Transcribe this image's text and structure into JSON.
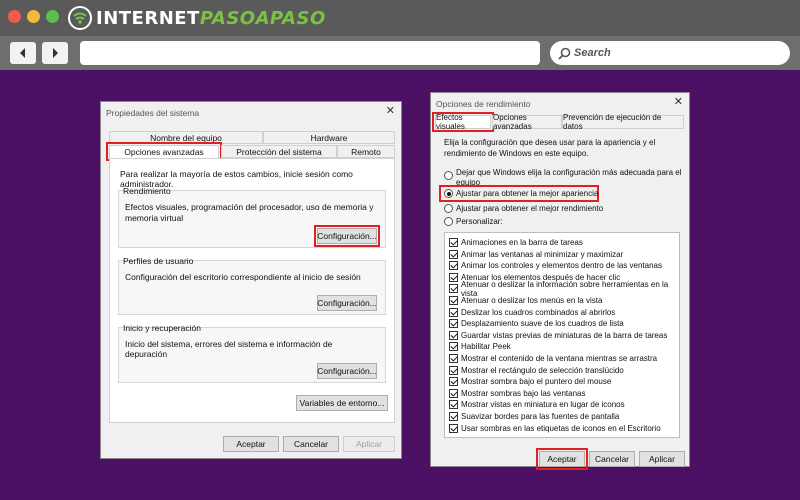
{
  "brand": {
    "name_white_1": "INTERNET",
    "name_green": "PASOAPASO",
    "colors": {
      "green": "#7cc242",
      "background": "#4b0f63",
      "highlight": "#e01f26"
    }
  },
  "browser": {
    "search_placeholder": "Search",
    "icons": [
      "back-arrow-icon",
      "forward-arrow-icon",
      "search-icon"
    ]
  },
  "system_properties": {
    "title": "Propiedades del sistema",
    "close": "✕",
    "tabs_row1": [
      "Nombre del equipo",
      "Hardware"
    ],
    "tabs_row2": [
      "Opciones avanzadas",
      "Protección del sistema",
      "Remoto"
    ],
    "admin_note": "Para realizar la mayoría de estos cambios, inicie sesión como administrador.",
    "performance": {
      "title": "Rendimiento",
      "desc": "Efectos visuales, programación del procesador, uso de memoria y memoria virtual",
      "button": "Configuración..."
    },
    "profiles": {
      "title": "Perfiles de usuario",
      "desc": "Configuración del escritorio correspondiente al inicio de sesión",
      "button": "Configuración..."
    },
    "startup": {
      "title": "Inicio y recuperación",
      "desc": "Inicio del sistema, errores del sistema e información de depuración",
      "button": "Configuración..."
    },
    "env_button": "Variables de entorno...",
    "ok": "Aceptar",
    "cancel": "Cancelar",
    "apply": "Aplicar"
  },
  "performance_options": {
    "title": "Opciones de rendimiento",
    "close": "✕",
    "tabs": [
      "Efectos visuales",
      "Opciones avanzadas",
      "Prevención de ejecución de datos"
    ],
    "intro": "Elija la configuración que desea usar para la apariencia y el rendimiento de Windows en este equipo.",
    "radios": [
      {
        "label": "Dejar que Windows elija la configuración más adecuada para el equipo",
        "checked": false
      },
      {
        "label": "Ajustar para obtener la mejor apariencia",
        "checked": true
      },
      {
        "label": "Ajustar para obtener el mejor rendimiento",
        "checked": false
      },
      {
        "label": "Personalizar:",
        "checked": false
      }
    ],
    "effects": [
      "Animaciones en la barra de tareas",
      "Animar las ventanas al minimizar y maximizar",
      "Animar los controles y elementos dentro de las ventanas",
      "Atenuar los elementos después de hacer clic",
      "Atenuar o deslizar la información sobre herramientas en la vista",
      "Atenuar o deslizar los menús en la vista",
      "Deslizar los cuadros combinados al abrirlos",
      "Desplazamiento suave de los cuadros de lista",
      "Guardar vistas previas de miniaturas de la barra de tareas",
      "Habilitar Peek",
      "Mostrar el contenido de la ventana mientras se arrastra",
      "Mostrar el rectángulo de selección translúcido",
      "Mostrar sombra bajo el puntero del mouse",
      "Mostrar sombras bajo las ventanas",
      "Mostrar vistas en miniatura en lugar de iconos",
      "Suavizar bordes para las fuentes de pantalla",
      "Usar sombras en las etiquetas de iconos en el Escritorio"
    ],
    "ok": "Aceptar",
    "cancel": "Cancelar",
    "apply": "Aplicar"
  }
}
